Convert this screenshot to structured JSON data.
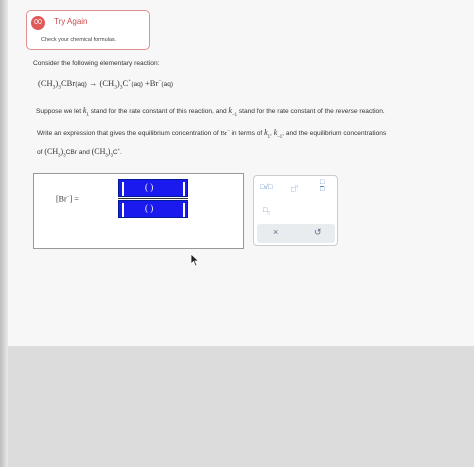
{
  "alert": {
    "badge": "00",
    "title": "Try Again",
    "message": "Check your chemical formulas."
  },
  "question": {
    "intro": "Consider the following elementary reaction:",
    "reaction": {
      "reactant_formula": "(CH",
      "reactant_sub": "3",
      "reactant_rest": ")",
      "reactant_sub2": "3",
      "reactant_tail": "CBr",
      "reactant_phase": "(aq)",
      "arrow": "→",
      "product1_formula": "(CH",
      "product1_sub": "3",
      "product1_rest": ")",
      "product1_sub2": "3",
      "product1_tail": "C",
      "product1_charge": "+",
      "product1_phase": "(aq)",
      "plus": "+",
      "product2_formula": "Br",
      "product2_charge": "−",
      "product2_phase": "(aq)"
    },
    "line2_a": "Suppose we let ",
    "k1": "k",
    "k1_sub": "1",
    "line2_b": " stand for the rate constant of this reaction, and ",
    "km1": "k",
    "km1_sub": "−1",
    "line2_c": " stand for the rate constant of the ",
    "line2_reverse": "reverse",
    "line2_d": " reaction.",
    "line3_a": "Write an expression that gives the equilibrium concentration of ",
    "line3_br": "Br",
    "line3_br_charge": "−",
    "line3_b": " in terms of ",
    "line3_k1": "k",
    "line3_k1_sub": "1",
    "line3_sep": ", ",
    "line3_km1": "k",
    "line3_km1_sub": "−1",
    "line3_c": ", and the equilibrium concentrations",
    "line4_a": "of ",
    "line4_f1": "(CH",
    "line4_f1_sub": "3",
    "line4_f1_rest": ")",
    "line4_f1_sub2": "3",
    "line4_f1_tail": "CBr",
    "line4_and": " and ",
    "line4_f2": "(CH",
    "line4_f2_sub": "3",
    "line4_f2_rest": ")",
    "line4_f2_sub2": "3",
    "line4_f2_tail": "C",
    "line4_f2_charge": "+",
    "line4_end": "."
  },
  "answer": {
    "lhs_open": "[",
    "lhs_species": "Br",
    "lhs_charge": "−",
    "lhs_close": "]",
    "equals": "=",
    "numerator": "( )",
    "denominator": "( )"
  },
  "toolbox": {
    "sqrt_tool": "□√□",
    "power_tool": "□",
    "power_sup": "□",
    "fraction_top": "□",
    "fraction_bottom": "□",
    "subscript_tool": "□",
    "subscript_sub": "□",
    "clear_label": "×",
    "undo_label": "↺"
  },
  "colors": {
    "alert_red": "#e05a5a",
    "input_blue": "#1a1aee",
    "tool_blue": "#5a8ac8"
  }
}
